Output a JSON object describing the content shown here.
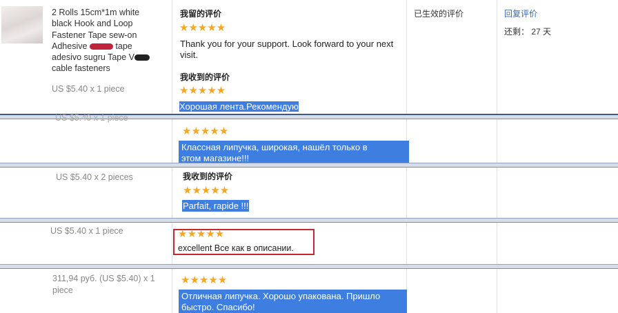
{
  "product": {
    "title_line1": "2 Rolls 15cm*1m white",
    "title_line2": "black Hook and Loop",
    "title_line3": "Fastener Tape sew-on",
    "title_line4a": "Adhesive",
    "title_line4b": "tape",
    "title_line5a": "adesivo sugru Tape",
    "title_line5b": "V",
    "title_line6": "cable fasteners",
    "price": "US $5.40 x 1 piece"
  },
  "review1": {
    "my_label": "我留的评价",
    "my_stars": "★★★★★",
    "my_text": "Thank you for your support. Look forward to your next visit.",
    "received_label": "我收到的评价",
    "received_stars": "★★★★★",
    "received_text": "Хорошая лента.Рекомендую",
    "status": "已生效的评价",
    "reply_link": "回复评价",
    "remaining": "还剩： 27 天"
  },
  "row2": {
    "price_partial": "US $5.40 x 1 piece",
    "stars": "★★★★★",
    "text_line1": "Классная липучка, широкая, нашёл только в",
    "text_line2": "этом магазине!!!"
  },
  "row3": {
    "price": "US $5.40 x 2 pieces",
    "label": "我收到的评价",
    "stars": "★★★★★",
    "text": "Parfait, rapide !!!"
  },
  "row4": {
    "price": "US $5.40 x 1 piece",
    "stars": "★★★★★",
    "text": "excellent Все как в описании."
  },
  "row5": {
    "price_line1": "311,94 руб. (US $5.40) x 1",
    "price_line2": "piece",
    "stars": "★★★★★",
    "text_line1": "Отличная липучка. Хорошо упакована. Пришло",
    "text_line2": "быстро. Спасибо!"
  },
  "colors": {
    "highlight": "#3d7ee0",
    "star": "#f5a623",
    "link": "#3a6cb0",
    "red_box": "#c9262f"
  }
}
